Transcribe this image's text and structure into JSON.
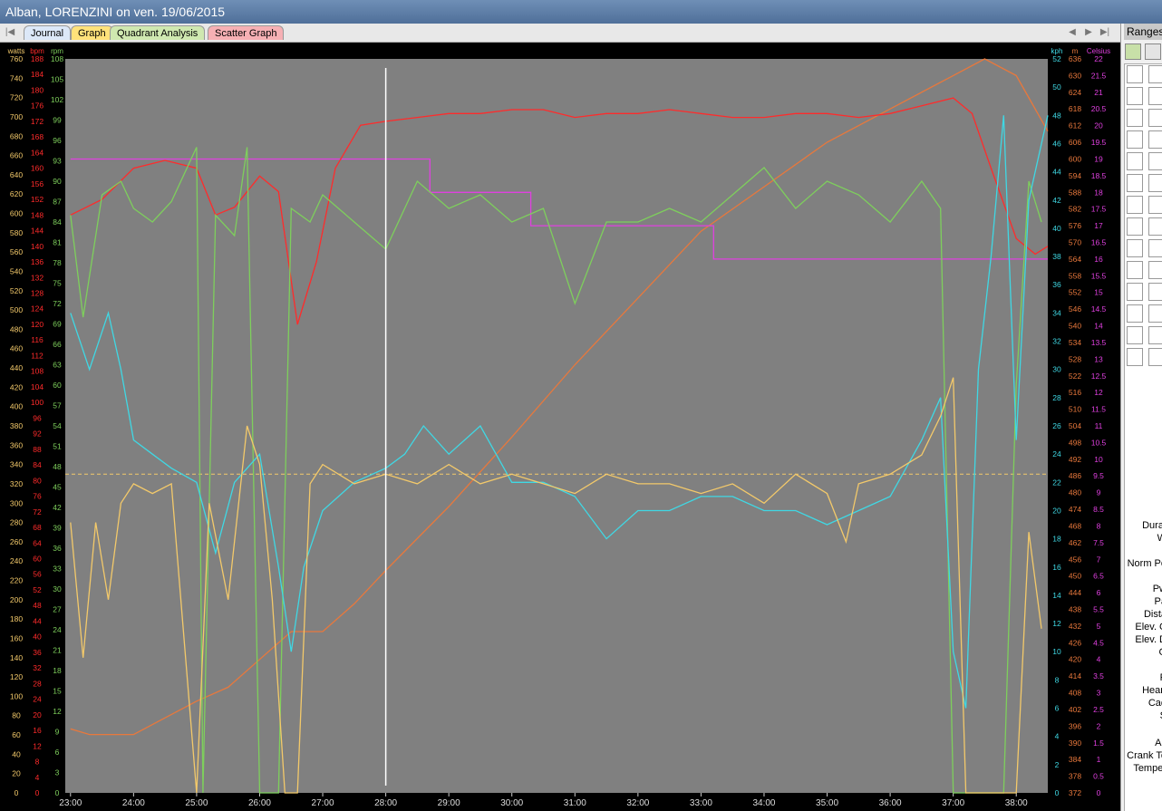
{
  "window": {
    "title": "Alban, LORENZINI on ven. 19/06/2015"
  },
  "tabs": [
    {
      "label": "Journal"
    },
    {
      "label": "Graph"
    },
    {
      "label": "Quadrant Analysis"
    },
    {
      "label": "Scatter Graph"
    }
  ],
  "right_panel": {
    "header": "Ranges",
    "labels": [
      "Durat",
      "W",
      "Norm Po",
      "Pw",
      "Pa",
      "Dista",
      "Elev. C",
      "Elev. D",
      "G",
      "P",
      "Heart",
      "Cad",
      "S",
      "Alt",
      "Crank To",
      "Temper"
    ]
  },
  "colors": {
    "plot_bg": "#808080",
    "watts": "#f3c96a",
    "bpm": "#ff2b2b",
    "rpm": "#7ecf5c",
    "kph": "#3fd8e4",
    "m": "#e8783c",
    "celsius": "#e040e0",
    "elevation": "#e8783c"
  },
  "chart_data": {
    "type": "line",
    "x_ticks": [
      "23:00",
      "24:00",
      "25:00",
      "26:00",
      "27:00",
      "28:00",
      "29:00",
      "30:00",
      "31:00",
      "32:00",
      "33:00",
      "34:00",
      "35:00",
      "36:00",
      "37:00",
      "38:00"
    ],
    "xlim": [
      "22:55",
      "38:30"
    ],
    "cursor_time": "28:00",
    "avg_power_line": 330,
    "axes": {
      "watts": {
        "label": "watts",
        "range": [
          0,
          760
        ],
        "ticks": [
          "0",
          "20",
          "40",
          "60",
          "80",
          "100",
          "120",
          "140",
          "160",
          "180",
          "200",
          "220",
          "240",
          "260",
          "280",
          "300",
          "320",
          "340",
          "360",
          "380",
          "400",
          "420",
          "440",
          "460",
          "480",
          "500",
          "520",
          "540",
          "560",
          "580",
          "600",
          "620",
          "640",
          "660",
          "680",
          "700",
          "720",
          "740",
          "760"
        ]
      },
      "bpm": {
        "label": "bpm",
        "range": [
          0,
          188
        ],
        "ticks": [
          "0",
          "4",
          "8",
          "12",
          "16",
          "20",
          "24",
          "28",
          "32",
          "36",
          "40",
          "44",
          "48",
          "52",
          "56",
          "60",
          "64",
          "68",
          "72",
          "76",
          "80",
          "84",
          "88",
          "92",
          "96",
          "100",
          "104",
          "108",
          "112",
          "116",
          "120",
          "124",
          "128",
          "132",
          "136",
          "140",
          "144",
          "148",
          "152",
          "156",
          "160",
          "164",
          "168",
          "172",
          "176",
          "180",
          "184",
          "188"
        ]
      },
      "rpm": {
        "label": "rpm",
        "range": [
          0,
          108
        ],
        "ticks": [
          "0",
          "3",
          "6",
          "9",
          "12",
          "15",
          "18",
          "21",
          "24",
          "27",
          "30",
          "33",
          "36",
          "39",
          "42",
          "45",
          "48",
          "51",
          "54",
          "57",
          "60",
          "63",
          "66",
          "69",
          "72",
          "75",
          "78",
          "81",
          "84",
          "87",
          "90",
          "93",
          "96",
          "99",
          "102",
          "105",
          "108"
        ]
      },
      "kph": {
        "label": "kph",
        "range": [
          0,
          52
        ],
        "ticks": [
          "0",
          "2",
          "4",
          "6",
          "8",
          "10",
          "12",
          "14",
          "16",
          "18",
          "20",
          "22",
          "24",
          "26",
          "28",
          "30",
          "32",
          "34",
          "36",
          "38",
          "40",
          "42",
          "44",
          "46",
          "48",
          "50",
          "52"
        ]
      },
      "m": {
        "label": "m",
        "range": [
          372,
          636
        ],
        "ticks": [
          "372",
          "378",
          "384",
          "390",
          "396",
          "402",
          "408",
          "414",
          "420",
          "426",
          "432",
          "438",
          "444",
          "450",
          "456",
          "462",
          "468",
          "474",
          "480",
          "486",
          "492",
          "498",
          "504",
          "510",
          "516",
          "522",
          "528",
          "534",
          "540",
          "546",
          "552",
          "558",
          "564",
          "570",
          "576",
          "582",
          "588",
          "594",
          "600",
          "606",
          "612",
          "618",
          "624",
          "630",
          "636"
        ]
      },
      "celsius": {
        "label": "Celsius",
        "range": [
          0,
          22
        ],
        "ticks": [
          "0",
          "0.5",
          "1",
          "1.5",
          "2",
          "2.5",
          "3",
          "3.5",
          "4",
          "4.5",
          "5",
          "5.5",
          "6",
          "6.5",
          "7",
          "7.5",
          "8",
          "8.5",
          "9",
          "9.5",
          "10",
          "10.5",
          "11",
          "11.5",
          "12",
          "12.5",
          "13",
          "13.5",
          "14",
          "14.5",
          "15",
          "15.5",
          "16",
          "16.5",
          "17",
          "17.5",
          "18",
          "18.5",
          "19",
          "19.5",
          "20",
          "20.5",
          "21",
          "21.5",
          "22"
        ]
      }
    },
    "series": [
      {
        "name": "watts",
        "color": "#f3c96a",
        "x": [
          23.0,
          23.2,
          23.4,
          23.6,
          23.8,
          24.0,
          24.3,
          24.6,
          25.0,
          25.2,
          25.5,
          25.8,
          26.0,
          26.2,
          26.4,
          26.6,
          26.8,
          27.0,
          27.5,
          28.0,
          28.5,
          29.0,
          29.5,
          30.0,
          30.5,
          31.0,
          31.5,
          32.0,
          32.5,
          33.0,
          33.5,
          34.0,
          34.5,
          35.0,
          35.3,
          35.5,
          36.0,
          36.5,
          36.8,
          37.0,
          37.2,
          37.4,
          37.6,
          37.8,
          38.0,
          38.2,
          38.4
        ],
        "values": [
          280,
          140,
          280,
          200,
          300,
          320,
          310,
          320,
          0,
          300,
          200,
          380,
          340,
          200,
          0,
          0,
          320,
          340,
          320,
          330,
          320,
          340,
          320,
          330,
          320,
          310,
          330,
          320,
          320,
          310,
          320,
          300,
          330,
          310,
          260,
          320,
          330,
          350,
          390,
          430,
          0,
          0,
          0,
          0,
          0,
          270,
          170
        ]
      },
      {
        "name": "bpm",
        "color": "#ff2b2b",
        "x": [
          23.0,
          23.5,
          24.0,
          24.5,
          25.0,
          25.3,
          25.6,
          26.0,
          26.3,
          26.6,
          26.9,
          27.2,
          27.6,
          28.0,
          28.5,
          29.0,
          29.5,
          30.0,
          30.5,
          31.0,
          31.5,
          32.0,
          32.5,
          33.0,
          33.5,
          34.0,
          34.5,
          35.0,
          35.5,
          36.0,
          36.5,
          37.0,
          37.3,
          37.6,
          38.0,
          38.3,
          38.5
        ],
        "values": [
          148,
          152,
          160,
          162,
          160,
          148,
          150,
          158,
          154,
          120,
          136,
          160,
          171,
          172,
          173,
          174,
          174,
          175,
          175,
          173,
          174,
          174,
          175,
          174,
          173,
          173,
          174,
          174,
          173,
          174,
          176,
          178,
          174,
          160,
          142,
          138,
          140
        ]
      },
      {
        "name": "rpm",
        "color": "#7ecf5c",
        "x": [
          23.0,
          23.2,
          23.5,
          23.8,
          24.0,
          24.3,
          24.6,
          25.0,
          25.1,
          25.3,
          25.6,
          25.8,
          26.0,
          26.3,
          26.5,
          26.8,
          27.0,
          27.5,
          28.0,
          28.5,
          29.0,
          29.5,
          30.0,
          30.5,
          31.0,
          31.5,
          32.0,
          32.5,
          33.0,
          33.5,
          34.0,
          34.5,
          35.0,
          35.5,
          36.0,
          36.5,
          36.8,
          37.0,
          37.2,
          37.4,
          37.6,
          37.8,
          38.0,
          38.2,
          38.4
        ],
        "values": [
          85,
          70,
          88,
          90,
          86,
          84,
          87,
          95,
          0,
          85,
          82,
          95,
          0,
          0,
          86,
          84,
          88,
          84,
          80,
          90,
          86,
          88,
          84,
          86,
          72,
          84,
          84,
          86,
          84,
          88,
          92,
          86,
          90,
          88,
          84,
          90,
          86,
          0,
          0,
          0,
          0,
          0,
          60,
          90,
          84
        ]
      },
      {
        "name": "kph",
        "color": "#3fd8e4",
        "x": [
          23.0,
          23.3,
          23.6,
          23.8,
          24.0,
          24.3,
          24.6,
          25.0,
          25.3,
          25.6,
          26.0,
          26.3,
          26.5,
          26.7,
          27.0,
          27.5,
          28.0,
          28.3,
          28.6,
          29.0,
          29.5,
          30.0,
          30.5,
          31.0,
          31.5,
          32.0,
          32.5,
          33.0,
          33.5,
          34.0,
          34.5,
          35.0,
          35.5,
          36.0,
          36.5,
          36.8,
          37.0,
          37.2,
          37.4,
          37.6,
          37.8,
          38.0,
          38.2,
          38.5
        ],
        "values": [
          34,
          30,
          34,
          30,
          25,
          24,
          23,
          22,
          17,
          22,
          24,
          16,
          10,
          16,
          20,
          22,
          23,
          24,
          26,
          24,
          26,
          22,
          22,
          21,
          18,
          20,
          20,
          21,
          21,
          20,
          20,
          19,
          20,
          21,
          25,
          28,
          10,
          6,
          30,
          38,
          48,
          25,
          42,
          48
        ]
      },
      {
        "name": "elevation",
        "color": "#e8783c",
        "x": [
          23.0,
          23.3,
          24.0,
          24.5,
          25.0,
          25.5,
          26.0,
          26.5,
          27.0,
          27.5,
          28.0,
          29.0,
          30.0,
          31.0,
          32.0,
          33.0,
          34.0,
          35.0,
          36.0,
          37.0,
          37.5,
          38.0,
          38.5
        ],
        "values": [
          395,
          393,
          393,
          399,
          405,
          410,
          420,
          430,
          430,
          440,
          452,
          475,
          500,
          526,
          550,
          574,
          590,
          606,
          618,
          630,
          636,
          630,
          610
        ]
      },
      {
        "name": "celsius",
        "color": "#e040e0",
        "x": [
          23.0,
          28.7,
          28.7,
          30.3,
          30.3,
          33.2,
          33.2,
          38.5
        ],
        "values": [
          19,
          19,
          18,
          18,
          17,
          17,
          16,
          16
        ]
      }
    ]
  }
}
